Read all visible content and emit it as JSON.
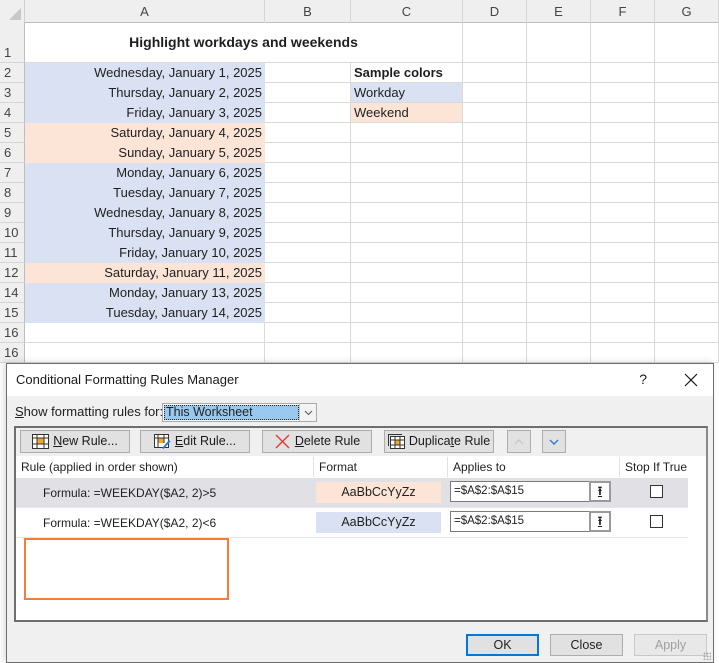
{
  "sheet": {
    "columns": [
      "A",
      "B",
      "C",
      "D",
      "E",
      "F",
      "G"
    ],
    "row_numbers": [
      "1",
      "2",
      "3",
      "4",
      "5",
      "6",
      "7",
      "8",
      "9",
      "10",
      "11",
      "12",
      "14",
      "15",
      "16",
      "16"
    ],
    "title": "Highlight workdays and weekends",
    "dates": [
      {
        "text": "Wednesday, January 1, 2025",
        "type": "workday"
      },
      {
        "text": "Thursday, January 2, 2025",
        "type": "workday"
      },
      {
        "text": "Friday, January 3, 2025",
        "type": "workday"
      },
      {
        "text": "Saturday, January 4, 2025",
        "type": "weekend"
      },
      {
        "text": "Sunday, January 5, 2025",
        "type": "weekend"
      },
      {
        "text": "Monday, January 6, 2025",
        "type": "workday"
      },
      {
        "text": "Tuesday, January 7, 2025",
        "type": "workday"
      },
      {
        "text": "Wednesday, January 8, 2025",
        "type": "workday"
      },
      {
        "text": "Thursday, January 9, 2025",
        "type": "workday"
      },
      {
        "text": "Friday, January 10, 2025",
        "type": "workday"
      },
      {
        "text": "Saturday, January 11, 2025",
        "type": "weekend"
      },
      {
        "text": "Monday, January 13, 2025",
        "type": "workday"
      },
      {
        "text": "Tuesday, January 14, 2025",
        "type": "workday"
      }
    ],
    "sample": {
      "header": "Sample colors",
      "workday_label": "Workday",
      "weekend_label": "Weekend"
    },
    "colors": {
      "workday": "#d9e1f2",
      "weekend": "#fce4d6"
    }
  },
  "dialog": {
    "title": "Conditional Formatting Rules Manager",
    "help_label": "?",
    "show_rules_label": "Show formatting rules for:",
    "show_rules_value": "This Worksheet",
    "toolbar": {
      "new_rule": "New Rule...",
      "edit_rule": "Edit Rule...",
      "delete_rule": "Delete Rule",
      "duplicate_rule": "Duplicate Rule"
    },
    "columns": {
      "rule": "Rule (applied in order shown)",
      "format": "Format",
      "applies_to": "Applies to",
      "stop_if_true": "Stop If True"
    },
    "rules": [
      {
        "formula": "Formula: =WEEKDAY($A2, 2)>5",
        "preview": "AaBbCcYyZz",
        "applies_to": "=$A$2:$A$15",
        "stop_if_true": false,
        "selected": true,
        "format_color": "#fce4d6"
      },
      {
        "formula": "Formula: =WEEKDAY($A2, 2)<6",
        "preview": "AaBbCcYyZz",
        "applies_to": "=$A$2:$A$15",
        "stop_if_true": false,
        "selected": false,
        "format_color": "#d9e1f2"
      }
    ],
    "buttons": {
      "ok": "OK",
      "close": "Close",
      "apply": "Apply"
    },
    "accent_color": "#0078d7",
    "highlight_color": "#f07e3c"
  }
}
